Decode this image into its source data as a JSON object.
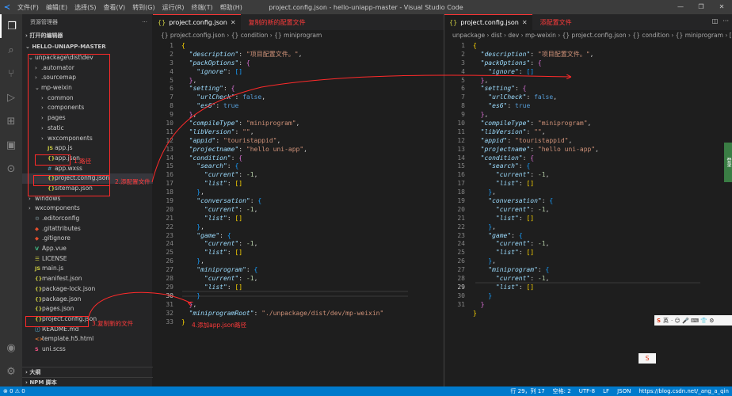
{
  "window": {
    "title": "project.config.json - hello-uniapp-master - Visual Studio Code",
    "menu": [
      "文件(F)",
      "编辑(E)",
      "选择(S)",
      "查看(V)",
      "转到(G)",
      "运行(R)",
      "终端(T)",
      "帮助(H)"
    ],
    "controls": [
      "—",
      "❐",
      "✕"
    ]
  },
  "sidebar": {
    "header": "资源管理器",
    "header_more": "···",
    "open_editors": "打开的编辑器",
    "project": "HELLO-UNIAPP-MASTER",
    "items": [
      {
        "label": "unpackage\\dist\\dev",
        "chev": "⌄",
        "icon": "",
        "indent": 0
      },
      {
        "label": ".automator",
        "chev": "›",
        "icon": "",
        "indent": 1
      },
      {
        "label": ".sourcemap",
        "chev": "›",
        "icon": "",
        "indent": 1
      },
      {
        "label": "mp-weixin",
        "chev": "⌄",
        "icon": "",
        "indent": 1
      },
      {
        "label": "common",
        "chev": "›",
        "icon": "",
        "indent": 2
      },
      {
        "label": "components",
        "chev": "›",
        "icon": "",
        "indent": 2
      },
      {
        "label": "pages",
        "chev": "›",
        "icon": "",
        "indent": 2
      },
      {
        "label": "static",
        "chev": "›",
        "icon": "",
        "indent": 2
      },
      {
        "label": "wxcomponents",
        "chev": "›",
        "icon": "",
        "indent": 2
      },
      {
        "label": "app.js",
        "chev": "",
        "icon": "JS",
        "kind": "js",
        "indent": 2
      },
      {
        "label": "app.json",
        "chev": "",
        "icon": "{}",
        "kind": "json",
        "indent": 2
      },
      {
        "label": "app.wxss",
        "chev": "",
        "icon": "#",
        "kind": "css",
        "indent": 2
      },
      {
        "label": "project.config.json",
        "chev": "",
        "icon": "{}",
        "kind": "json",
        "indent": 2
      },
      {
        "label": "sitemap.json",
        "chev": "",
        "icon": "{}",
        "kind": "json",
        "indent": 2
      },
      {
        "label": "windows",
        "chev": "›",
        "icon": "",
        "indent": 0
      },
      {
        "label": "wxcomponents",
        "chev": "›",
        "icon": "",
        "indent": 0
      },
      {
        "label": ".editorconfig",
        "chev": "",
        "icon": "⚙",
        "kind": "cfg",
        "indent": 0
      },
      {
        "label": ".gitattributes",
        "chev": "",
        "icon": "◆",
        "kind": "git",
        "indent": 0
      },
      {
        "label": ".gitignore",
        "chev": "",
        "icon": "◆",
        "kind": "git",
        "indent": 0
      },
      {
        "label": "App.vue",
        "chev": "",
        "icon": "V",
        "kind": "vue",
        "indent": 0
      },
      {
        "label": "LICENSE",
        "chev": "",
        "icon": "☰",
        "kind": "lic",
        "indent": 0
      },
      {
        "label": "main.js",
        "chev": "",
        "icon": "JS",
        "kind": "js",
        "indent": 0
      },
      {
        "label": "manifest.json",
        "chev": "",
        "icon": "{}",
        "kind": "json",
        "indent": 0
      },
      {
        "label": "package-lock.json",
        "chev": "",
        "icon": "{}",
        "kind": "json",
        "indent": 0
      },
      {
        "label": "package.json",
        "chev": "",
        "icon": "{}",
        "kind": "json",
        "indent": 0
      },
      {
        "label": "pages.json",
        "chev": "",
        "icon": "{}",
        "kind": "json",
        "indent": 0
      },
      {
        "label": "project.config.json",
        "chev": "",
        "icon": "{}",
        "kind": "json",
        "indent": 0
      },
      {
        "label": "README.md",
        "chev": "",
        "icon": "ⓘ",
        "kind": "md",
        "indent": 0
      },
      {
        "label": "template.h5.html",
        "chev": "",
        "icon": "<>",
        "kind": "html",
        "indent": 0
      },
      {
        "label": "uni.scss",
        "chev": "",
        "icon": "S",
        "kind": "scss",
        "indent": 0
      }
    ],
    "outline": "大纲",
    "npm": "NPM 脚本"
  },
  "annotations": {
    "path": "1.路径",
    "add_config": "2.添配置文件",
    "copy_new": "3.复制新的文件",
    "add_app_json": "4.添加app.json路径",
    "left_tab_note": "复制的新的配置文件",
    "right_tab_note": "添配置文件"
  },
  "editor_left": {
    "tab": "project.config.json",
    "breadcrumb": "{} project.config.json › {} condition › {} miniprogram",
    "line_numbers": [
      1,
      2,
      3,
      4,
      5,
      6,
      7,
      8,
      9,
      10,
      11,
      12,
      13,
      14,
      15,
      16,
      17,
      18,
      19,
      20,
      21,
      22,
      23,
      24,
      25,
      26,
      27,
      28,
      29,
      30,
      31,
      32,
      33
    ],
    "code": [
      "{",
      "  \"description\": \"项目配置文件。\",",
      "  \"packOptions\": {",
      "    \"ignore\": []",
      "  },",
      "  \"setting\": {",
      "    \"urlCheck\": false,",
      "    \"es6\": true",
      "  },",
      "  \"compileType\": \"miniprogram\",",
      "  \"libVersion\": \"\",",
      "  \"appid\": \"touristappid\",",
      "  \"projectname\": \"hello uni-app\",",
      "  \"condition\": {",
      "    \"search\": {",
      "      \"current\": -1,",
      "      \"list\": []",
      "    },",
      "    \"conversation\": {",
      "      \"current\": -1,",
      "      \"list\": []",
      "    },",
      "    \"game\": {",
      "      \"current\": -1,",
      "      \"list\": []",
      "    },",
      "    \"miniprogram\": {",
      "      \"current\": -1,",
      "      \"list\": []",
      "    }",
      "  },",
      "  \"miniprogramRoot\": \"./unpackage/dist/dev/mp-weixin\"",
      "}"
    ]
  },
  "editor_right": {
    "tab": "project.config.json",
    "breadcrumb": "unpackage › dist › dev › mp-weixin › {} project.config.json › {} condition › {} miniprogram › [ ] list",
    "line_numbers": [
      1,
      2,
      3,
      4,
      5,
      6,
      7,
      8,
      9,
      10,
      11,
      12,
      13,
      14,
      15,
      16,
      17,
      18,
      19,
      20,
      21,
      22,
      23,
      24,
      25,
      26,
      27,
      28,
      29,
      30,
      31
    ],
    "code": [
      "{",
      "  \"description\": \"项目配置文件。\",",
      "  \"packOptions\": {",
      "    \"ignore\": []",
      "  },",
      "  \"setting\": {",
      "    \"urlCheck\": false,",
      "    \"es6\": true",
      "  },",
      "  \"compileType\": \"miniprogram\",",
      "  \"libVersion\": \"\",",
      "  \"appid\": \"touristappid\",",
      "  \"projectname\": \"hello uni-app\",",
      "  \"condition\": {",
      "    \"search\": {",
      "      \"current\": -1,",
      "      \"list\": []",
      "    },",
      "    \"conversation\": {",
      "      \"current\": -1,",
      "      \"list\": []",
      "    },",
      "    \"game\": {",
      "      \"current\": -1,",
      "      \"list\": []",
      "    },",
      "    \"miniprogram\": {",
      "      \"current\": -1,",
      "      \"list\": []",
      "    }",
      "  }",
      "}"
    ]
  },
  "statusbar": {
    "left": "⊗ 0  ⚠ 0",
    "position": "行 29，列 17",
    "spaces": "空格: 2",
    "encoding": "UTF-8",
    "eol": "LF",
    "language": "JSON",
    "watermark": "https://blog.csdn.net/_ang_a_qin"
  },
  "ime": {
    "label": "英",
    "icons": "· ☺ 🎤 ⌨ 👕 ⚙"
  }
}
